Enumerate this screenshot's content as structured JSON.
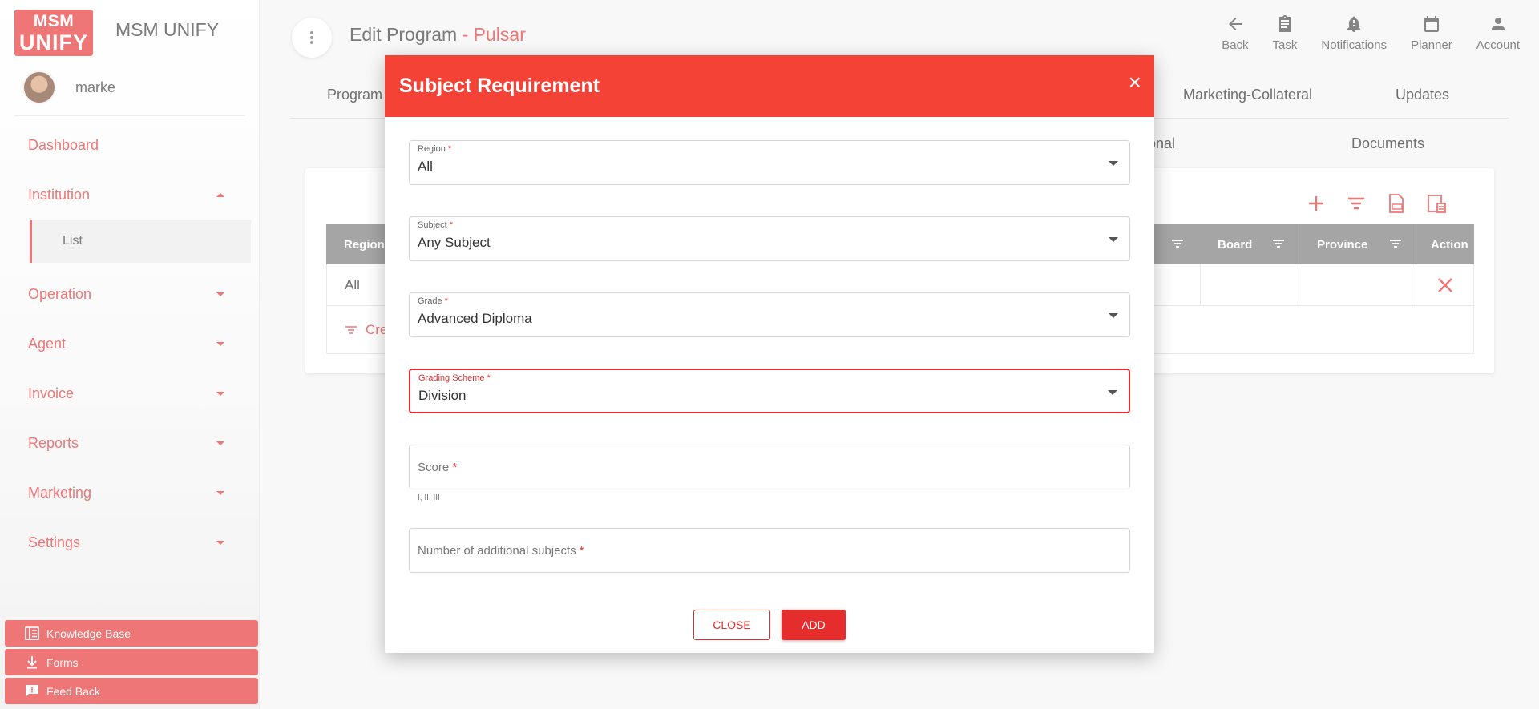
{
  "brand": {
    "logo_top": "MSM",
    "logo_bottom": "UNIFY",
    "name": "MSM UNIFY"
  },
  "user": {
    "name": "marke"
  },
  "sidebar": {
    "items": [
      {
        "label": "Dashboard"
      },
      {
        "label": "Institution",
        "sub": [
          {
            "label": "List"
          }
        ]
      },
      {
        "label": "Operation"
      },
      {
        "label": "Agent"
      },
      {
        "label": "Invoice"
      },
      {
        "label": "Reports"
      },
      {
        "label": "Marketing"
      },
      {
        "label": "Settings"
      }
    ],
    "buttons": [
      {
        "label": "Knowledge Base"
      },
      {
        "label": "Forms"
      },
      {
        "label": "Feed Back"
      }
    ]
  },
  "header": {
    "title": "Edit Program",
    "separator": " - ",
    "program_name": "Pulsar",
    "actions": [
      {
        "label": "Back"
      },
      {
        "label": "Task"
      },
      {
        "label": "Notifications"
      },
      {
        "label": "Planner"
      },
      {
        "label": "Account"
      }
    ]
  },
  "tabs": {
    "row1": {
      "left": "Program",
      "marketing": "Marketing-Collateral",
      "updates": "Updates"
    },
    "row2": {
      "partial": "onal",
      "documents": "Documents"
    }
  },
  "table": {
    "headers": {
      "region": "Region",
      "board": "Board",
      "province": "Province",
      "action": "Action"
    },
    "rows": [
      {
        "region": "All"
      }
    ],
    "footer_partial": "Cre"
  },
  "modal": {
    "title": "Subject Requirement",
    "close_symbol": "×",
    "fields": {
      "region": {
        "label": "Region",
        "value": "All"
      },
      "subject": {
        "label": "Subject",
        "value": "Any Subject"
      },
      "grade": {
        "label": "Grade",
        "value": "Advanced Diploma"
      },
      "grading_scheme": {
        "label": "Grading Scheme",
        "value": "Division"
      },
      "score": {
        "placeholder": "Score",
        "hint": "I, II, III"
      },
      "additional": {
        "placeholder": "Number of additional subjects"
      }
    },
    "required_mark": "*",
    "close_label": "CLOSE",
    "add_label": "ADD"
  },
  "colors": {
    "accent": "#e52d2d",
    "modal_header": "#f44336",
    "table_header": "#757575"
  }
}
